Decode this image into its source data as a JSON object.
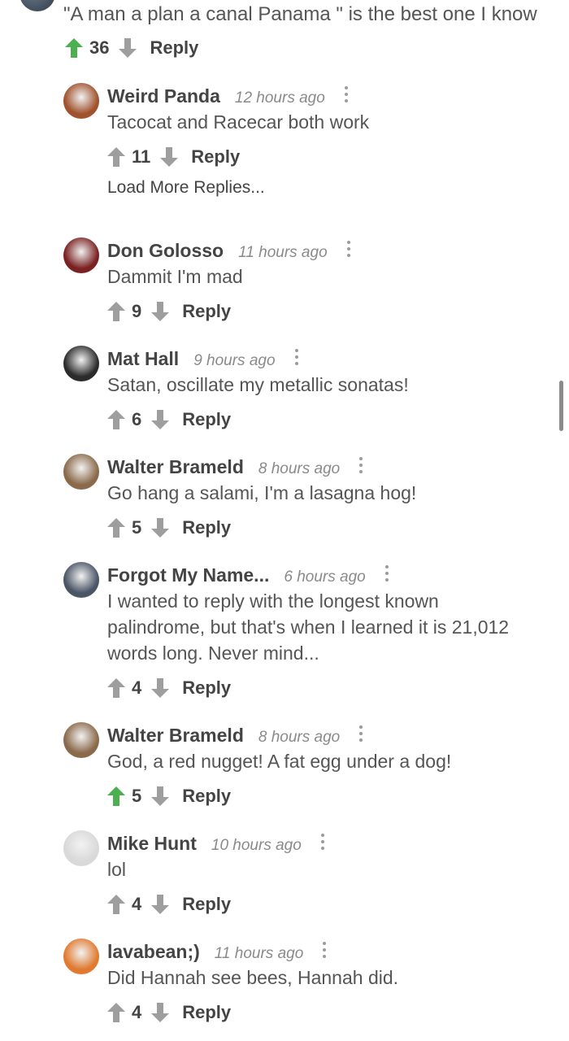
{
  "top_comment": {
    "text": "\"A man a plan a canal Panama \" is the best one I know",
    "votes": "36",
    "upvoted": true,
    "reply_label": "Reply"
  },
  "load_more": "Load More Replies...",
  "comments": [
    {
      "author": "Weird Panda",
      "time": "12 hours ago",
      "text": "Tacocat and Racecar both work",
      "votes": "11",
      "upvoted": false,
      "reply": "Reply",
      "avatar_color": "#a0522d"
    },
    {
      "author": "Don Golosso",
      "time": "11 hours ago",
      "text": "Dammit I'm mad",
      "votes": "9",
      "upvoted": false,
      "reply": "Reply",
      "avatar_color": "#7a2222"
    },
    {
      "author": "Mat Hall",
      "time": "9 hours ago",
      "text": "Satan, oscillate my metallic sonatas!",
      "votes": "6",
      "upvoted": false,
      "reply": "Reply",
      "avatar_color": "#2b2b2b"
    },
    {
      "author": "Walter Brameld",
      "time": "8 hours ago",
      "text": "Go hang a salami, I'm a lasagna hog!",
      "votes": "5",
      "upvoted": false,
      "reply": "Reply",
      "avatar_color": "#8a6a4a"
    },
    {
      "author": "Forgot My Name...",
      "time": "6 hours ago",
      "text_lines": [
        "I wanted to reply with the longest known",
        "palindrome, but that's when I learned it is 21,012",
        "words long. Never mind..."
      ],
      "votes": "4",
      "upvoted": false,
      "reply": "Reply",
      "avatar_color": "#4a5566"
    },
    {
      "author": "Walter Brameld",
      "time": "8 hours ago",
      "text": "God, a red nugget! A fat egg under a dog!",
      "votes": "5",
      "upvoted": true,
      "reply": "Reply",
      "avatar_color": "#8a6a4a"
    },
    {
      "author": "Mike Hunt",
      "time": "10 hours ago",
      "text": "lol",
      "votes": "4",
      "upvoted": false,
      "reply": "Reply",
      "avatar_color": "#d9d9d9"
    },
    {
      "author": "lavabean;)",
      "time": "11 hours ago",
      "text": "Did Hannah see bees, Hannah did.",
      "votes": "4",
      "upvoted": false,
      "reply": "Reply",
      "avatar_color": "#e07a30"
    }
  ],
  "colors": {
    "upvote_active": "#4caf50",
    "vote_inactive": "#9e9e9e"
  }
}
